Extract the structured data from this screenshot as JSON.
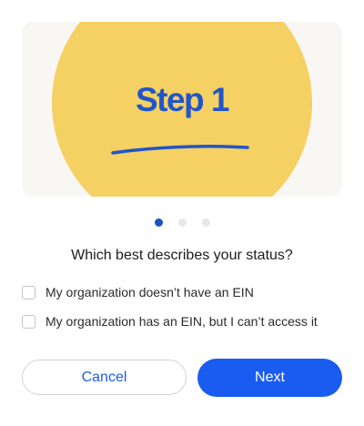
{
  "hero": {
    "step_title": "Step 1"
  },
  "pagination": {
    "total": 3,
    "active_index": 0
  },
  "question": "Which best describes your status?",
  "options": [
    {
      "label": "My organization doesn’t have an EIN",
      "checked": false
    },
    {
      "label": "My organization has an EIN, but I can’t access it",
      "checked": false
    }
  ],
  "buttons": {
    "cancel_label": "Cancel",
    "next_label": "Next"
  },
  "colors": {
    "accent": "#1a5cf0",
    "hero_circle": "#f4d162",
    "hero_background": "#f8f7f4",
    "step_title": "#2255cc",
    "dot_active": "#2050c8",
    "dot_inactive": "#e7e7ea"
  }
}
